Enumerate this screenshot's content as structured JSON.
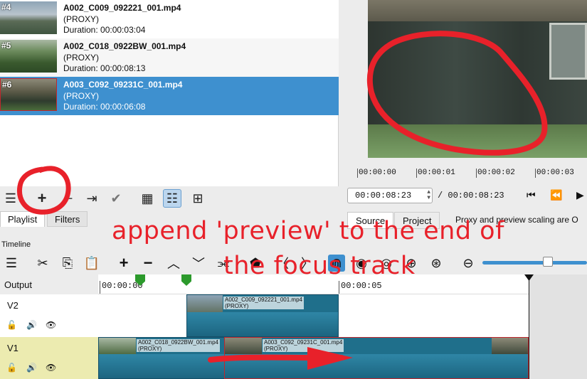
{
  "playlist": {
    "items": [
      {
        "num": "#4",
        "filename": "A002_C009_092221_001.mp4",
        "proxy": "(PROXY)",
        "duration": "Duration: 00:00:03:04"
      },
      {
        "num": "#5",
        "filename": "A002_C018_0922BW_001.mp4",
        "proxy": "(PROXY)",
        "duration": "Duration: 00:00:08:13"
      },
      {
        "num": "#6",
        "filename": "A003_C092_09231C_001.mp4",
        "proxy": "(PROXY)",
        "duration": "Duration: 00:00:06:08",
        "selected": true
      }
    ],
    "toolbar_icons": [
      "menu-icon",
      "add-icon",
      "remove-icon",
      "update-icon",
      "checkmark-icon",
      "details-view-icon",
      "tiles-view-icon",
      "icons-view-icon"
    ]
  },
  "tabs": {
    "playlist": "Playlist",
    "filters": "Filters"
  },
  "viewer": {
    "ruler": [
      "00:00:00",
      "00:00:01",
      "00:00:02",
      "00:00:03"
    ],
    "timecode": "00:00:08:23",
    "total": "/ 00:00:08:23",
    "source_tab": "Source",
    "project_tab": "Project",
    "proxy_message": "Proxy and preview scaling are O"
  },
  "timeline": {
    "label": "Timeline",
    "ruler": [
      "00:00:00",
      "00:00:05"
    ],
    "output_label": "Output",
    "tracks": [
      {
        "name": "V2",
        "clips": [
          {
            "filename": "A002_C009_092221_001.mp4",
            "proxy": "(PROXY)"
          }
        ]
      },
      {
        "name": "V1",
        "clips": [
          {
            "filename": "A002_C018_0922BW_001.mp4",
            "proxy": "(PROXY)"
          },
          {
            "filename": "A003_C092_09231C_001.mp4",
            "proxy": "(PROXY)"
          }
        ]
      }
    ]
  },
  "annotation": {
    "line1": "append 'preview' to the end of",
    "line2": "the focus track",
    "color": "#e8212a"
  },
  "colors": {
    "selection": "#3e90cf",
    "clip": "#1f6f8b",
    "v1_header": "#ecebb0"
  }
}
